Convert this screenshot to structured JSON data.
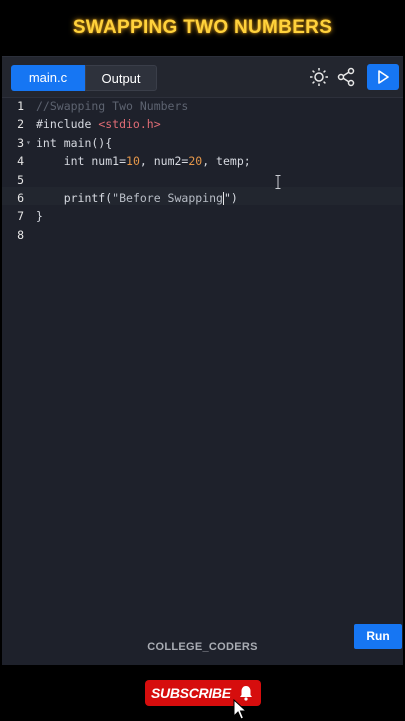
{
  "video": {
    "title": "SWAPPING TWO NUMBERS",
    "watermark": "COLLEGE_CODERS"
  },
  "toolbar": {
    "tabs": [
      {
        "label": "main.c",
        "active": true
      },
      {
        "label": "Output",
        "active": false
      }
    ],
    "icons": [
      "theme-sun-icon",
      "share-icon",
      "play-icon"
    ]
  },
  "editor": {
    "lines": [
      {
        "number": "1",
        "tokens": [
          {
            "text": "//Swapping Two Numbers",
            "kind": "comment"
          }
        ]
      },
      {
        "number": "2",
        "tokens": [
          {
            "text": "#include ",
            "kind": "plain"
          },
          {
            "text": "<stdio.h>",
            "kind": "include"
          }
        ]
      },
      {
        "number": "3",
        "fold": true,
        "tokens": [
          {
            "text": "int main(){",
            "kind": "plain"
          }
        ]
      },
      {
        "number": "4",
        "tokens": [
          {
            "text": "    int num1=",
            "kind": "plain"
          },
          {
            "text": "10",
            "kind": "number"
          },
          {
            "text": ", num2=",
            "kind": "plain"
          },
          {
            "text": "20",
            "kind": "number"
          },
          {
            "text": ", temp;",
            "kind": "plain"
          }
        ]
      },
      {
        "number": "5",
        "tokens": []
      },
      {
        "number": "6",
        "tokens": [
          {
            "text": "    printf(",
            "kind": "plain"
          },
          {
            "text": "\"Before Swapping",
            "kind": "string"
          },
          {
            "text": "\")",
            "kind": "plain"
          }
        ],
        "cursor_after_token": 1
      },
      {
        "number": "7",
        "tokens": [
          {
            "text": "}",
            "kind": "plain"
          }
        ]
      },
      {
        "number": "8",
        "tokens": []
      }
    ]
  },
  "run_button": {
    "label": "Run"
  },
  "subscribe": {
    "label": "SUBSCRIBE"
  },
  "colors": {
    "accent": "#1676f3",
    "title": "#ffd23c",
    "subscribe": "#d60d0d",
    "editor_bg": "#1e212b",
    "comment": "#5d6370",
    "number": "#e5974a",
    "include": "#e06c75"
  }
}
